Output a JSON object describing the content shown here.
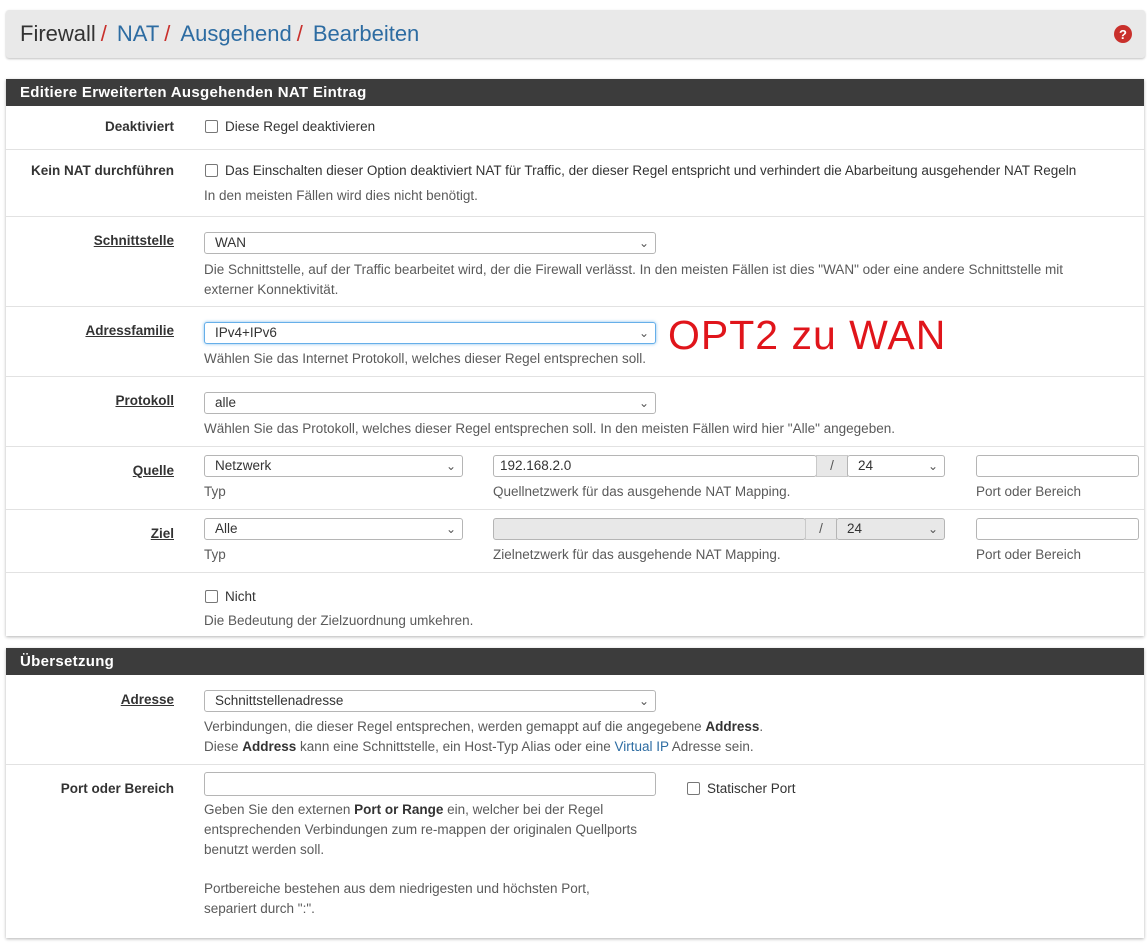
{
  "breadcrumb": {
    "items": [
      "Firewall",
      "NAT",
      "Ausgehend",
      "Bearbeiten"
    ],
    "separator": "/"
  },
  "help_icon": "question-circle-icon",
  "section1": {
    "title": "Editiere Erweiterten Ausgehenden NAT Eintrag",
    "disabled": {
      "label": "Deaktiviert",
      "checkbox_label": "Diese Regel deaktivieren"
    },
    "nonat": {
      "label": "Kein NAT durchführen",
      "checkbox_label": "Das Einschalten dieser Option deaktiviert NAT für Traffic, der dieser Regel entspricht und verhindert die Abarbeitung ausgehender NAT Regeln",
      "help": "In den meisten Fällen wird dies nicht benötigt."
    },
    "interface": {
      "label": "Schnittstelle",
      "value": "WAN",
      "help1": "Die Schnittstelle, auf der Traffic bearbeitet wird, der die Firewall verlässt. In den meisten Fällen ist dies \"WAN\" oder eine andere Schnittstelle mit",
      "help2": "externer Konnektivität."
    },
    "family": {
      "label": "Adressfamilie",
      "value": "IPv4+IPv6",
      "help": "Wählen Sie das Internet Protokoll, welches dieser Regel entsprechen soll."
    },
    "protocol": {
      "label": "Protokoll",
      "value": "alle",
      "help": "Wählen Sie das Protokoll, welches dieser Regel entsprechen soll. In den meisten Fällen wird hier \"Alle\" angegeben."
    },
    "source": {
      "label": "Quelle",
      "type": "Netzwerk",
      "type_help": "Typ",
      "address": "192.168.2.0",
      "slash": "/",
      "mask": "24",
      "address_help": "Quellnetzwerk für das ausgehende NAT Mapping.",
      "port": "",
      "port_help": "Port oder Bereich"
    },
    "destination": {
      "label": "Ziel",
      "type": "Alle",
      "type_help": "Typ",
      "address": "",
      "slash": "/",
      "mask": "24",
      "address_help": "Zielnetzwerk für das ausgehende NAT Mapping.",
      "port": "",
      "port_help": "Port oder Bereich"
    },
    "invert": {
      "checkbox_label": "Nicht",
      "help": "Die Bedeutung der Zielzuordnung umkehren."
    }
  },
  "section2": {
    "title": "Übersetzung",
    "address": {
      "label": "Adresse",
      "value": "Schnittstellenadresse",
      "help1_pre": "Verbindungen, die dieser Regel entsprechen, werden gemappt auf die angegebene ",
      "help1_bold": "Address",
      "help1_post": ".",
      "help2_pre": "Diese ",
      "help2_bold": "Address",
      "help2_mid": " kann eine Schnittstelle, ein Host-Typ Alias oder eine ",
      "help2_link": "Virtual IP",
      "help2_post": " Adresse sein."
    },
    "port": {
      "label": "Port oder Bereich",
      "value": "",
      "static_label": "Statischer Port",
      "help1_pre": "Geben Sie den externen ",
      "help1_bold": "Port or Range",
      "help1_post": " ein, welcher bei der Regel",
      "help2": "entsprechenden Verbindungen zum re-mappen der originalen Quellports",
      "help3": "benutzt werden soll.",
      "help4": "Portbereiche bestehen aus dem niedrigesten und höchsten Port,",
      "help5": "separiert durch \":\"."
    }
  },
  "annotation": "OPT2 zu WAN",
  "colors": {
    "heading_bg": "#3c3c3c",
    "link": "#2d6ca2",
    "accent_red": "#c9302c",
    "annotation": "#e0151b"
  }
}
